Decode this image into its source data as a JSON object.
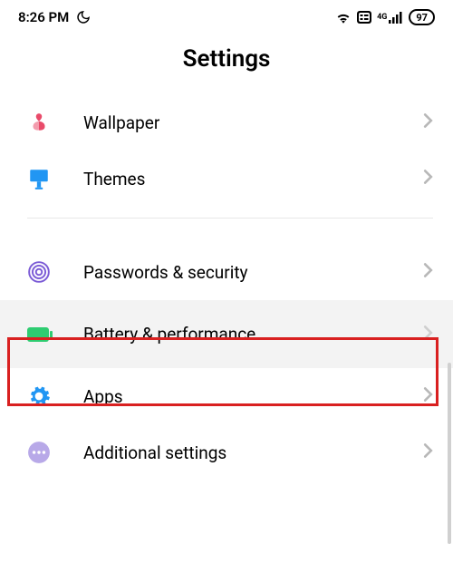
{
  "status": {
    "time": "8:26 PM",
    "battery_percent": "97",
    "network_label": "4G"
  },
  "header": {
    "title": "Settings"
  },
  "rows": {
    "wallpaper": {
      "label": "Wallpaper"
    },
    "themes": {
      "label": "Themes"
    },
    "passwords": {
      "label": "Passwords & security"
    },
    "battery": {
      "label": "Battery & performance"
    },
    "apps": {
      "label": "Apps"
    },
    "additional": {
      "label": "Additional settings"
    }
  }
}
